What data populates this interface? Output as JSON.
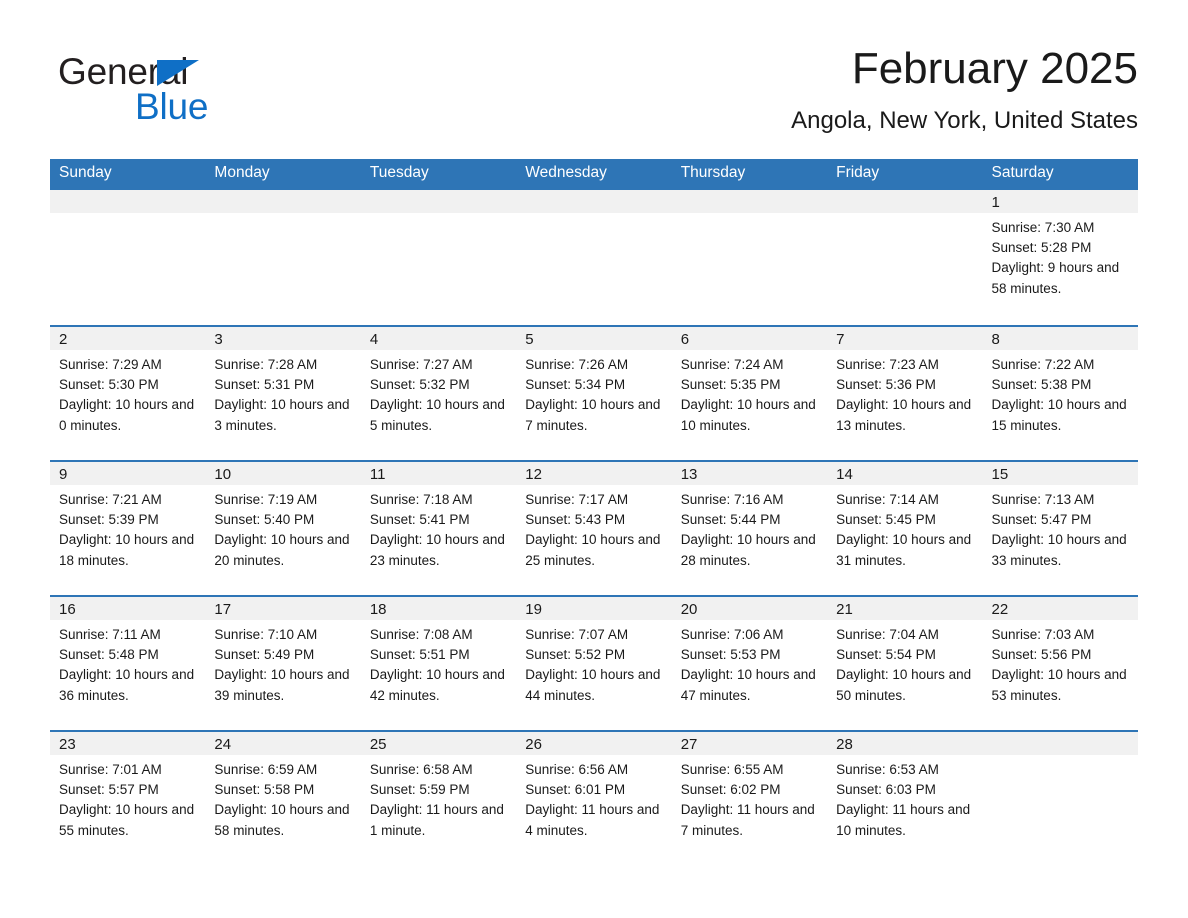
{
  "brand": {
    "name_part1": "General",
    "name_part2": "Blue",
    "triangle_color": "#0f6fc6"
  },
  "header": {
    "title": "February 2025",
    "subtitle": "Angola, New York, United States"
  },
  "theme": {
    "header_blue": "#2e75b6",
    "daynum_band": "#f1f1f1",
    "text": "#1a1a1a"
  },
  "weekday_headers": [
    "Sunday",
    "Monday",
    "Tuesday",
    "Wednesday",
    "Thursday",
    "Friday",
    "Saturday"
  ],
  "weeks": [
    [
      {
        "day": "",
        "sunrise": "",
        "sunset": "",
        "daylight": ""
      },
      {
        "day": "",
        "sunrise": "",
        "sunset": "",
        "daylight": ""
      },
      {
        "day": "",
        "sunrise": "",
        "sunset": "",
        "daylight": ""
      },
      {
        "day": "",
        "sunrise": "",
        "sunset": "",
        "daylight": ""
      },
      {
        "day": "",
        "sunrise": "",
        "sunset": "",
        "daylight": ""
      },
      {
        "day": "",
        "sunrise": "",
        "sunset": "",
        "daylight": ""
      },
      {
        "day": "1",
        "sunrise": "Sunrise: 7:30 AM",
        "sunset": "Sunset: 5:28 PM",
        "daylight": "Daylight: 9 hours and 58 minutes."
      }
    ],
    [
      {
        "day": "2",
        "sunrise": "Sunrise: 7:29 AM",
        "sunset": "Sunset: 5:30 PM",
        "daylight": "Daylight: 10 hours and 0 minutes."
      },
      {
        "day": "3",
        "sunrise": "Sunrise: 7:28 AM",
        "sunset": "Sunset: 5:31 PM",
        "daylight": "Daylight: 10 hours and 3 minutes."
      },
      {
        "day": "4",
        "sunrise": "Sunrise: 7:27 AM",
        "sunset": "Sunset: 5:32 PM",
        "daylight": "Daylight: 10 hours and 5 minutes."
      },
      {
        "day": "5",
        "sunrise": "Sunrise: 7:26 AM",
        "sunset": "Sunset: 5:34 PM",
        "daylight": "Daylight: 10 hours and 7 minutes."
      },
      {
        "day": "6",
        "sunrise": "Sunrise: 7:24 AM",
        "sunset": "Sunset: 5:35 PM",
        "daylight": "Daylight: 10 hours and 10 minutes."
      },
      {
        "day": "7",
        "sunrise": "Sunrise: 7:23 AM",
        "sunset": "Sunset: 5:36 PM",
        "daylight": "Daylight: 10 hours and 13 minutes."
      },
      {
        "day": "8",
        "sunrise": "Sunrise: 7:22 AM",
        "sunset": "Sunset: 5:38 PM",
        "daylight": "Daylight: 10 hours and 15 minutes."
      }
    ],
    [
      {
        "day": "9",
        "sunrise": "Sunrise: 7:21 AM",
        "sunset": "Sunset: 5:39 PM",
        "daylight": "Daylight: 10 hours and 18 minutes."
      },
      {
        "day": "10",
        "sunrise": "Sunrise: 7:19 AM",
        "sunset": "Sunset: 5:40 PM",
        "daylight": "Daylight: 10 hours and 20 minutes."
      },
      {
        "day": "11",
        "sunrise": "Sunrise: 7:18 AM",
        "sunset": "Sunset: 5:41 PM",
        "daylight": "Daylight: 10 hours and 23 minutes."
      },
      {
        "day": "12",
        "sunrise": "Sunrise: 7:17 AM",
        "sunset": "Sunset: 5:43 PM",
        "daylight": "Daylight: 10 hours and 25 minutes."
      },
      {
        "day": "13",
        "sunrise": "Sunrise: 7:16 AM",
        "sunset": "Sunset: 5:44 PM",
        "daylight": "Daylight: 10 hours and 28 minutes."
      },
      {
        "day": "14",
        "sunrise": "Sunrise: 7:14 AM",
        "sunset": "Sunset: 5:45 PM",
        "daylight": "Daylight: 10 hours and 31 minutes."
      },
      {
        "day": "15",
        "sunrise": "Sunrise: 7:13 AM",
        "sunset": "Sunset: 5:47 PM",
        "daylight": "Daylight: 10 hours and 33 minutes."
      }
    ],
    [
      {
        "day": "16",
        "sunrise": "Sunrise: 7:11 AM",
        "sunset": "Sunset: 5:48 PM",
        "daylight": "Daylight: 10 hours and 36 minutes."
      },
      {
        "day": "17",
        "sunrise": "Sunrise: 7:10 AM",
        "sunset": "Sunset: 5:49 PM",
        "daylight": "Daylight: 10 hours and 39 minutes."
      },
      {
        "day": "18",
        "sunrise": "Sunrise: 7:08 AM",
        "sunset": "Sunset: 5:51 PM",
        "daylight": "Daylight: 10 hours and 42 minutes."
      },
      {
        "day": "19",
        "sunrise": "Sunrise: 7:07 AM",
        "sunset": "Sunset: 5:52 PM",
        "daylight": "Daylight: 10 hours and 44 minutes."
      },
      {
        "day": "20",
        "sunrise": "Sunrise: 7:06 AM",
        "sunset": "Sunset: 5:53 PM",
        "daylight": "Daylight: 10 hours and 47 minutes."
      },
      {
        "day": "21",
        "sunrise": "Sunrise: 7:04 AM",
        "sunset": "Sunset: 5:54 PM",
        "daylight": "Daylight: 10 hours and 50 minutes."
      },
      {
        "day": "22",
        "sunrise": "Sunrise: 7:03 AM",
        "sunset": "Sunset: 5:56 PM",
        "daylight": "Daylight: 10 hours and 53 minutes."
      }
    ],
    [
      {
        "day": "23",
        "sunrise": "Sunrise: 7:01 AM",
        "sunset": "Sunset: 5:57 PM",
        "daylight": "Daylight: 10 hours and 55 minutes."
      },
      {
        "day": "24",
        "sunrise": "Sunrise: 6:59 AM",
        "sunset": "Sunset: 5:58 PM",
        "daylight": "Daylight: 10 hours and 58 minutes."
      },
      {
        "day": "25",
        "sunrise": "Sunrise: 6:58 AM",
        "sunset": "Sunset: 5:59 PM",
        "daylight": "Daylight: 11 hours and 1 minute."
      },
      {
        "day": "26",
        "sunrise": "Sunrise: 6:56 AM",
        "sunset": "Sunset: 6:01 PM",
        "daylight": "Daylight: 11 hours and 4 minutes."
      },
      {
        "day": "27",
        "sunrise": "Sunrise: 6:55 AM",
        "sunset": "Sunset: 6:02 PM",
        "daylight": "Daylight: 11 hours and 7 minutes."
      },
      {
        "day": "28",
        "sunrise": "Sunrise: 6:53 AM",
        "sunset": "Sunset: 6:03 PM",
        "daylight": "Daylight: 11 hours and 10 minutes."
      },
      {
        "day": "",
        "sunrise": "",
        "sunset": "",
        "daylight": ""
      }
    ]
  ]
}
